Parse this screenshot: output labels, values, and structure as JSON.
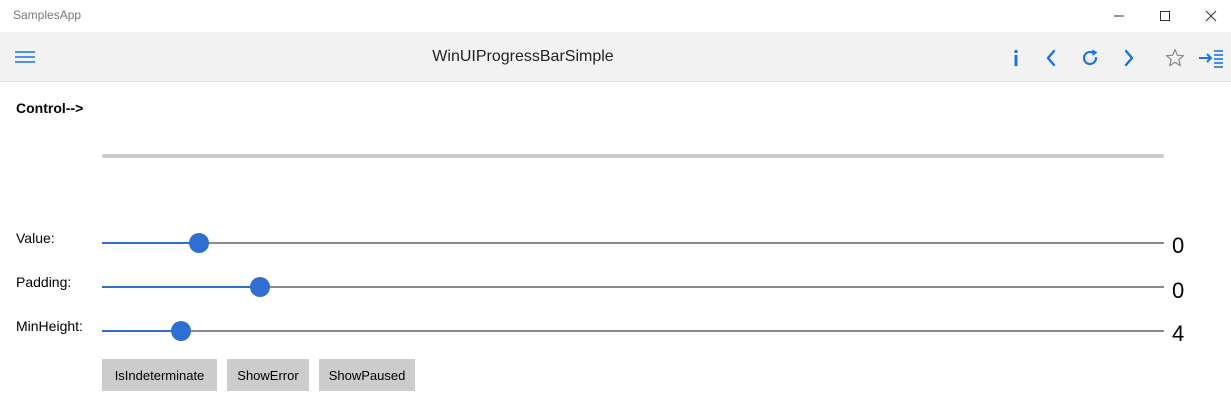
{
  "window": {
    "app_title": "SamplesApp",
    "minimize_icon": "minimize-icon",
    "maximize_icon": "maximize-icon",
    "close_icon": "close-icon"
  },
  "nav": {
    "page_title": "WinUIProgressBarSimple",
    "menu_icon": "hamburger-menu-icon",
    "info_icon": "info-icon",
    "back_icon": "chevron-left-icon",
    "refresh_icon": "refresh-icon",
    "forward_icon": "chevron-right-icon",
    "favorite_icon": "star-outline-icon",
    "pin_icon": "arrow-to-list-icon",
    "accent_color": "#1a73e8"
  },
  "content": {
    "control_label": "Control-->",
    "progress": {
      "value": 0
    },
    "sliders": [
      {
        "label": "Value:",
        "value_text": "0",
        "fraction": 0.091
      },
      {
        "label": "Padding:",
        "value_text": "0",
        "fraction": 0.149
      },
      {
        "label": "MinHeight:",
        "value_text": "4",
        "fraction": 0.074
      }
    ],
    "buttons": {
      "indeterminate": "IsIndeterminate",
      "error": "ShowError",
      "paused": "ShowPaused"
    },
    "accent_color": "#2f6fd1"
  }
}
